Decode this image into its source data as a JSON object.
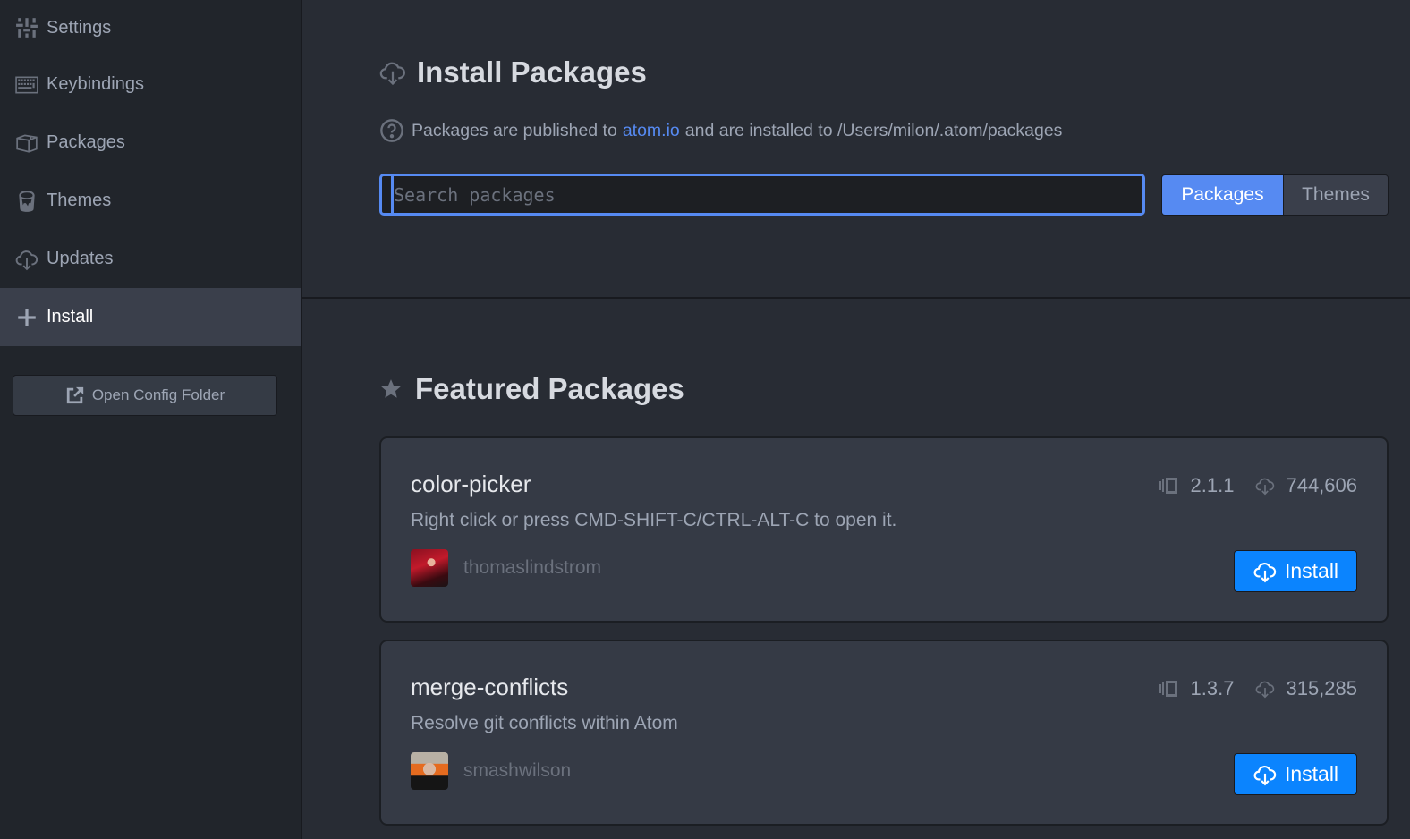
{
  "sidebar": {
    "items": [
      {
        "label": "Settings",
        "icon": "sliders-icon",
        "active": false
      },
      {
        "label": "Keybindings",
        "icon": "keyboard-icon",
        "active": false
      },
      {
        "label": "Packages",
        "icon": "package-icon",
        "active": false
      },
      {
        "label": "Themes",
        "icon": "paintcan-icon",
        "active": false
      },
      {
        "label": "Updates",
        "icon": "cloud-download-icon",
        "active": false
      },
      {
        "label": "Install",
        "icon": "plus-icon",
        "active": true
      }
    ],
    "open_config_label": "Open Config Folder"
  },
  "header": {
    "title": "Install Packages",
    "info_prefix": "Packages are published to",
    "info_link": "atom.io",
    "info_suffix": "and are installed to /Users/milon/.atom/packages"
  },
  "search": {
    "placeholder": "Search packages",
    "value": ""
  },
  "toggle": {
    "options": [
      "Packages",
      "Themes"
    ],
    "selected": "Packages"
  },
  "featured": {
    "title": "Featured Packages",
    "packages": [
      {
        "name": "color-picker",
        "description": "Right click or press CMD-SHIFT-C/CTRL-ALT-C to open it.",
        "owner": "thomaslindstrom",
        "version": "2.1.1",
        "downloads": "744,606",
        "install_label": "Install"
      },
      {
        "name": "merge-conflicts",
        "description": "Resolve git conflicts within Atom",
        "owner": "smashwilson",
        "version": "1.3.7",
        "downloads": "315,285",
        "install_label": "Install"
      }
    ]
  },
  "colors": {
    "accent": "#568af2",
    "install_button": "#0b84fe",
    "background": "#282c34",
    "sidebar": "#21252b",
    "card": "#353a45"
  }
}
